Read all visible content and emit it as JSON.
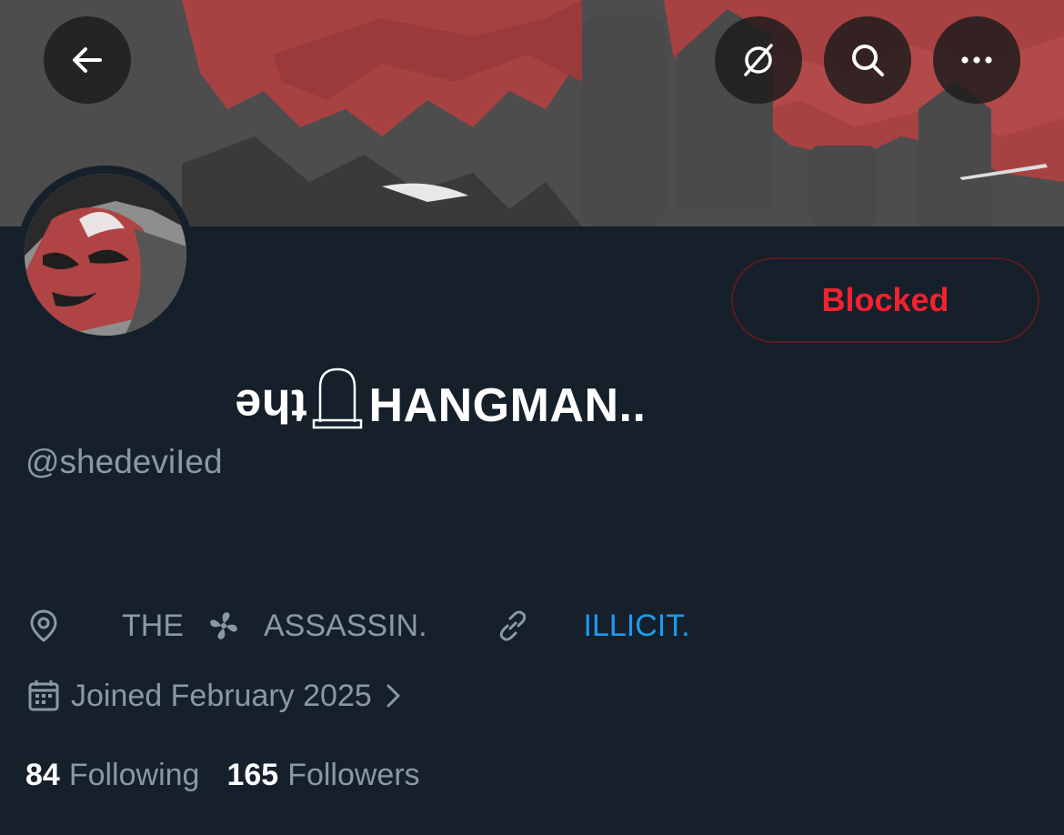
{
  "header": {
    "back_icon": "arrow-left-icon",
    "grok_icon": "grok-icon",
    "search_icon": "search-icon",
    "more_icon": "more-horizontal-icon"
  },
  "profile": {
    "display_name_flipped": "the",
    "display_name_main": "HANGMAN..",
    "handle": "@shedeviIed",
    "action_button": "Blocked",
    "location_part1": "THE",
    "location_part2": "ASSASSIN.",
    "website": "ILLICIT.",
    "joined": "Joined February 2025",
    "following_count": "84",
    "following_label": "Following",
    "followers_count": "165",
    "followers_label": "Followers"
  },
  "colors": {
    "background": "#15202b",
    "secondary_text": "#8b98a5",
    "link": "#1d9bf0",
    "blocked": "#f4212e",
    "banner_red": "#a84040"
  }
}
